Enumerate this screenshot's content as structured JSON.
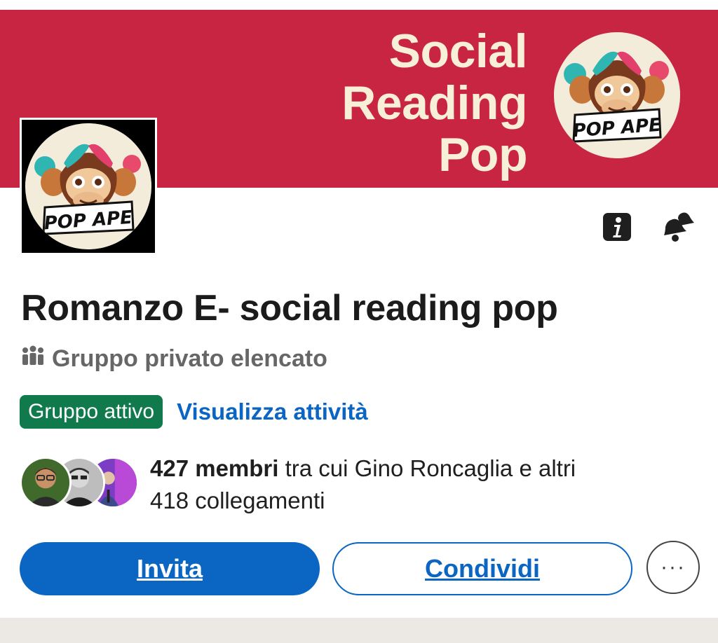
{
  "banner": {
    "title_lines": [
      "Social",
      "Reading",
      "Pop"
    ],
    "background": "#c72541",
    "title_color": "#f7efd8",
    "logo_text": "POP APE"
  },
  "group_logo": {
    "text": "POP APE"
  },
  "header_actions": {
    "info_icon": "info-icon",
    "notifications_icon": "bell-icon"
  },
  "group": {
    "name": "Romanzo E- social reading pop",
    "privacy": "Gruppo privato elencato",
    "privacy_icon": "people-icon",
    "active_badge": "Gruppo attivo",
    "activity_link": "Visualizza attività"
  },
  "members": {
    "count": "427 membri",
    "text_rest": " tra cui Gino Roncaglia e altri",
    "line2": "418 collegamenti"
  },
  "actions": {
    "invite_label": "Invita",
    "share_label": "Condividi",
    "more_label": "···"
  },
  "colors": {
    "accent": "#0a66c2",
    "active_badge": "#117a4d"
  }
}
